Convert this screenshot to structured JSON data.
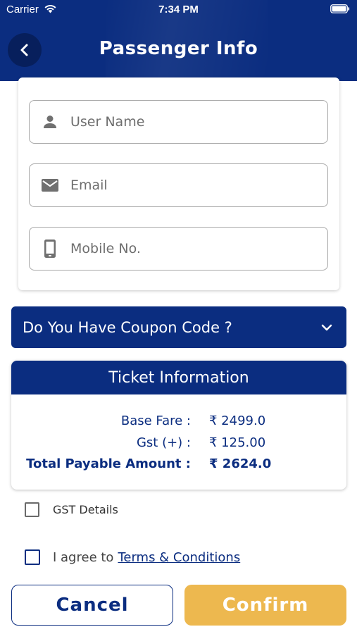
{
  "status_bar": {
    "carrier": "Carrier",
    "time": "7:34 PM"
  },
  "header": {
    "title": "Passenger Info",
    "back_icon": "chevron-left-icon"
  },
  "form": {
    "user_name_placeholder": "User Name",
    "email_placeholder": "Email",
    "mobile_placeholder": "Mobile No.",
    "icons": [
      "person-icon",
      "mail-icon",
      "phone-icon"
    ]
  },
  "coupon": {
    "label": "Do You Have Coupon Code ?",
    "icon": "chevron-down-icon"
  },
  "ticket": {
    "title": "Ticket Information",
    "rows": [
      {
        "label": "Base Fare :",
        "value": "₹ 2499.0"
      },
      {
        "label": "Gst (+) :",
        "value": "₹ 125.00"
      },
      {
        "label": "Total Payable Amount :",
        "value": "₹ 2624.0"
      }
    ]
  },
  "options": {
    "gst_label": "GST Details",
    "agree_prefix": "I agree to",
    "terms_link": "Terms & Conditions"
  },
  "actions": {
    "cancel_label": "Cancel",
    "confirm_label": "Confirm"
  },
  "colors": {
    "primary": "#0b2d80",
    "accent": "#edb84f"
  }
}
